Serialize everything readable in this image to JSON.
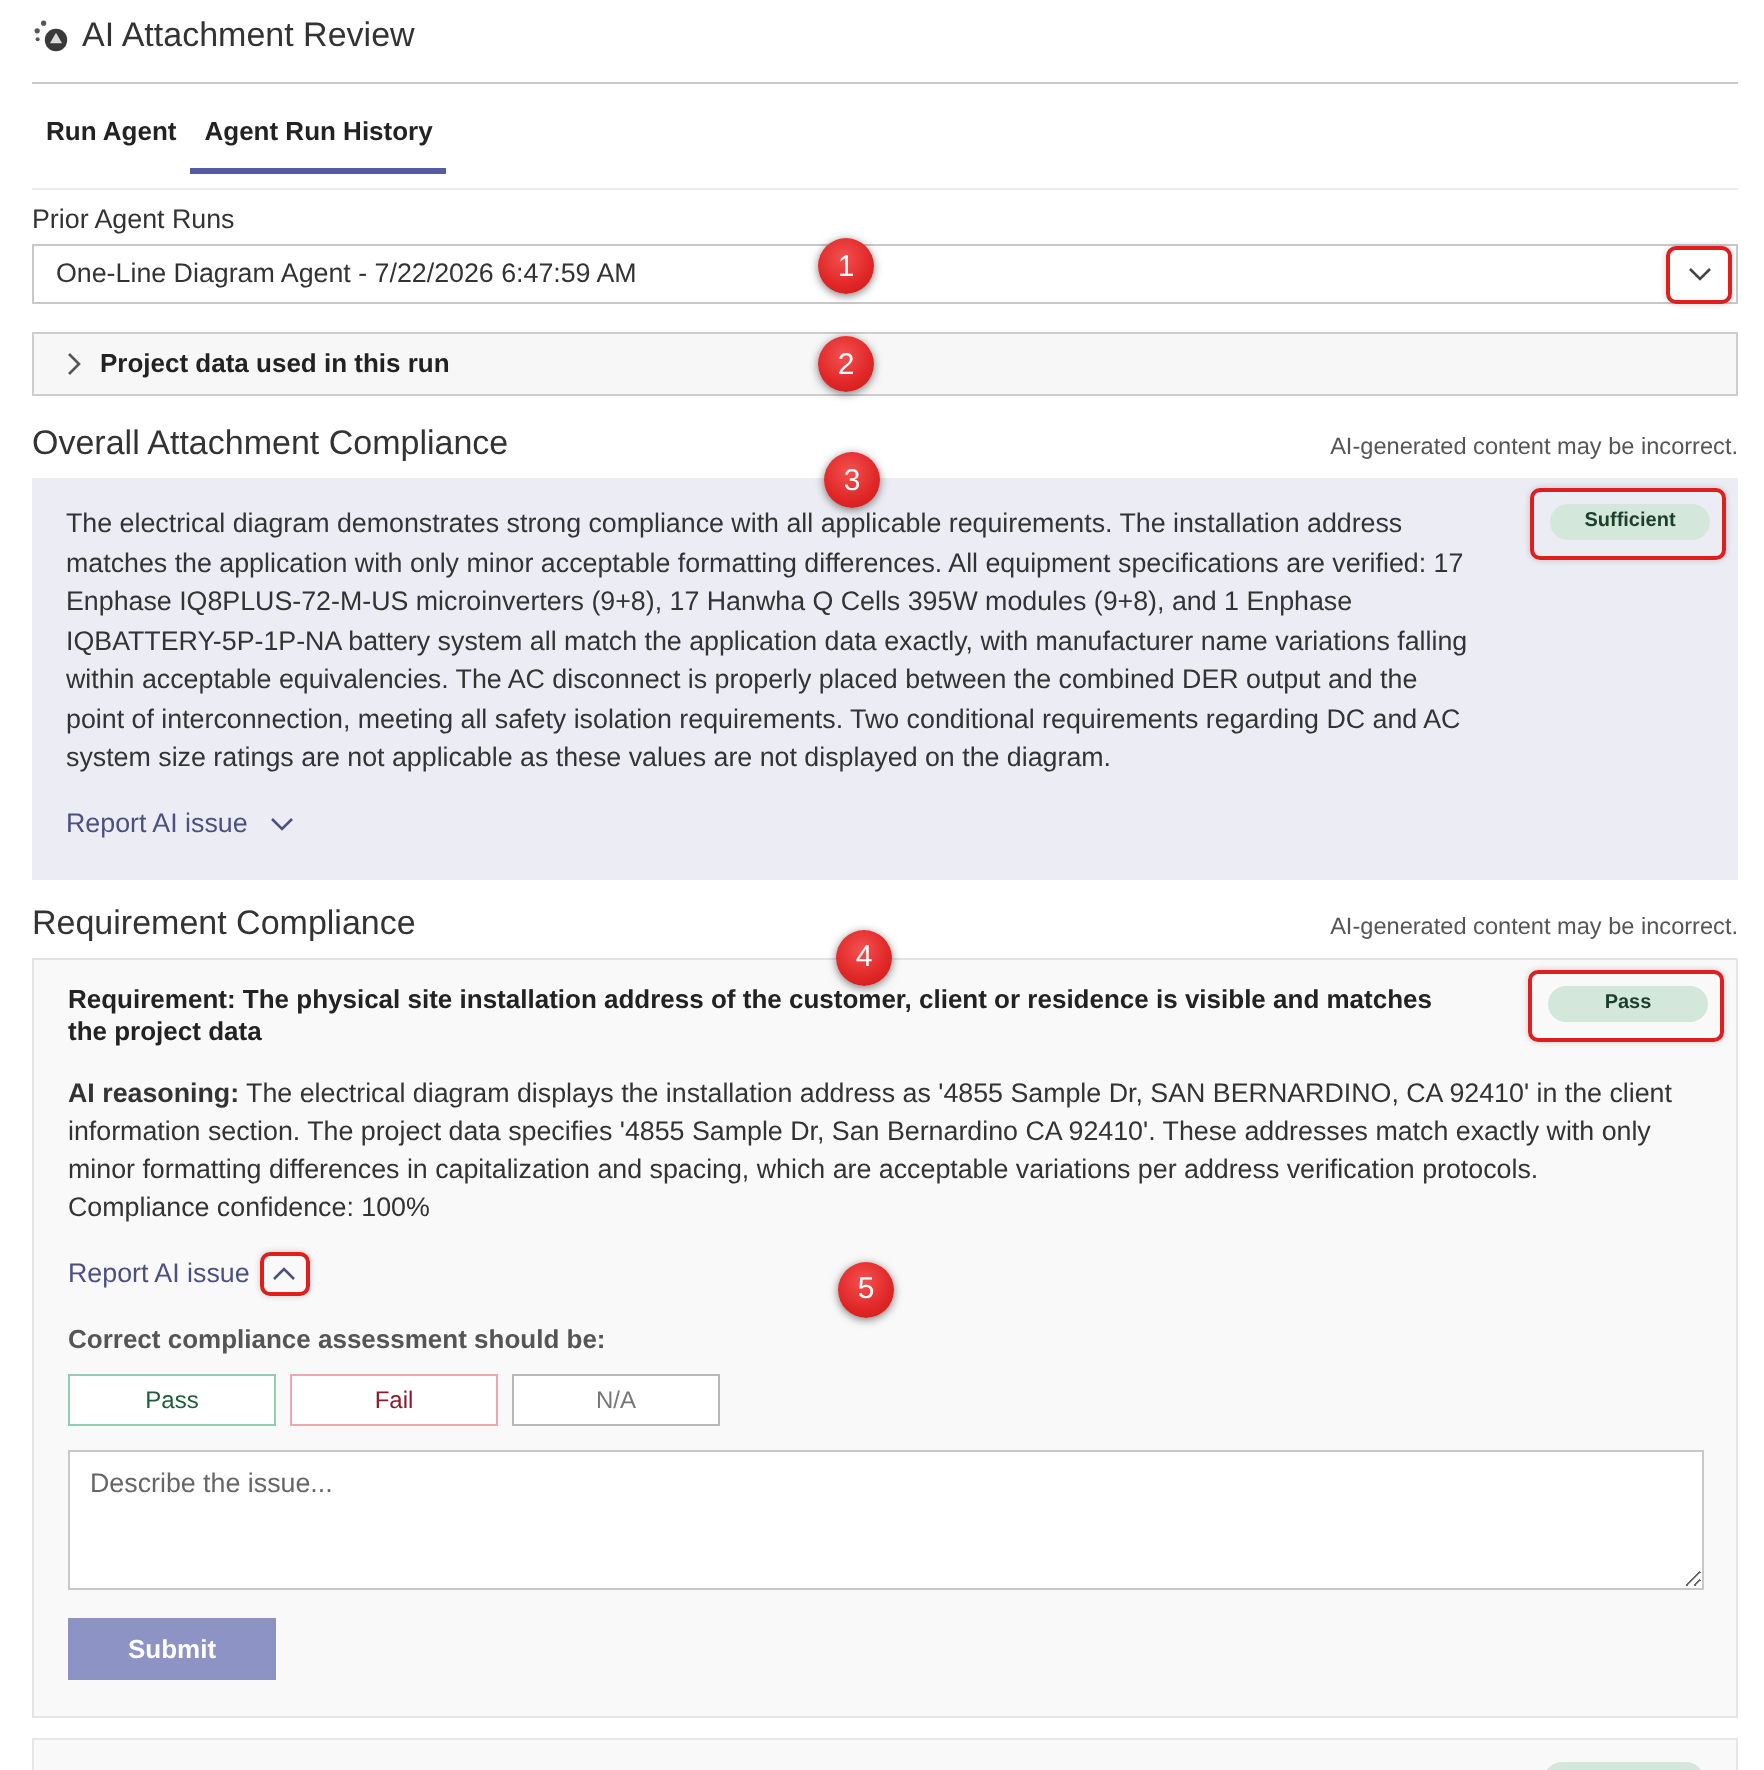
{
  "header": {
    "title": "AI Attachment Review"
  },
  "tabs": [
    {
      "label": "Run Agent",
      "selected": false
    },
    {
      "label": "Agent Run History",
      "selected": true
    }
  ],
  "prior_runs": {
    "label": "Prior Agent Runs",
    "value": "One-Line Diagram Agent - 7/22/2026 6:47:59 AM",
    "toggle_highlighted": true,
    "callout": "1"
  },
  "project_data": {
    "label": "Project data used in this run",
    "expanded": false,
    "callout": "2"
  },
  "overall": {
    "heading": "Overall Attachment Compliance",
    "note": "AI-generated content may be incorrect.",
    "callout": "3",
    "summary": "The electrical diagram demonstrates strong compliance with all applicable requirements. The installation address matches the application with only minor acceptable formatting differences. All equipment specifications are verified: 17 Enphase IQ8PLUS-72-M-US microinverters (9+8), 17 Hanwha Q Cells 395W modules (9+8), and 1 Enphase IQBATTERY-5P-1P-NA battery system all match the application data exactly, with manufacturer name variations falling within acceptable equivalencies. The AC disconnect is properly placed between the combined DER output and the point of interconnection, meeting all safety isolation requirements. Two conditional requirements regarding DC and AC system size ratings are not applicable as these values are not displayed on the diagram.",
    "status": {
      "label": "Sufficient",
      "kind": "pass",
      "highlighted": true
    },
    "report": {
      "label": "Report AI issue",
      "expanded": false,
      "highlighted": false
    }
  },
  "requirements_section": {
    "heading": "Requirement Compliance",
    "note": "AI-generated content may be incorrect.",
    "requirements": [
      {
        "kind": "full",
        "callout": "4",
        "requirement": "Requirement: The physical site installation address of the customer, client or residence is visible and matches the project data",
        "status": {
          "label": "Pass",
          "kind": "pass",
          "highlighted": true
        },
        "reasoning": "**AI reasoning:** The electrical diagram displays the installation address as '4855 Sample Dr, SAN BERNARDINO, CA 92410' in the client information section. The project data specifies '4855 Sample Dr, San Bernardino CA 92410'. These addresses match exactly with only minor formatting differences in capitalization and spacing, which are acceptable variations per address verification protocols.",
        "confidence": "Compliance confidence: 100%",
        "report": {
          "label": "Report AI issue",
          "expanded": true,
          "highlighted": true,
          "callout": "5",
          "form": {
            "prompt": "Correct compliance assessment should be:",
            "options": [
              {
                "label": "Pass",
                "kind": "pass",
                "selected": false
              },
              {
                "label": "Fail",
                "kind": "fail",
                "selected": false
              },
              {
                "label": "N/A",
                "kind": "na",
                "selected": false
              }
            ],
            "placeholder": "Describe the issue...",
            "submit": {
              "label": "Submit",
              "disabled": true
            }
          }
        }
      },
      {
        "kind": "cut_off",
        "status": {
          "kind": "pass"
        }
      }
    ]
  }
}
